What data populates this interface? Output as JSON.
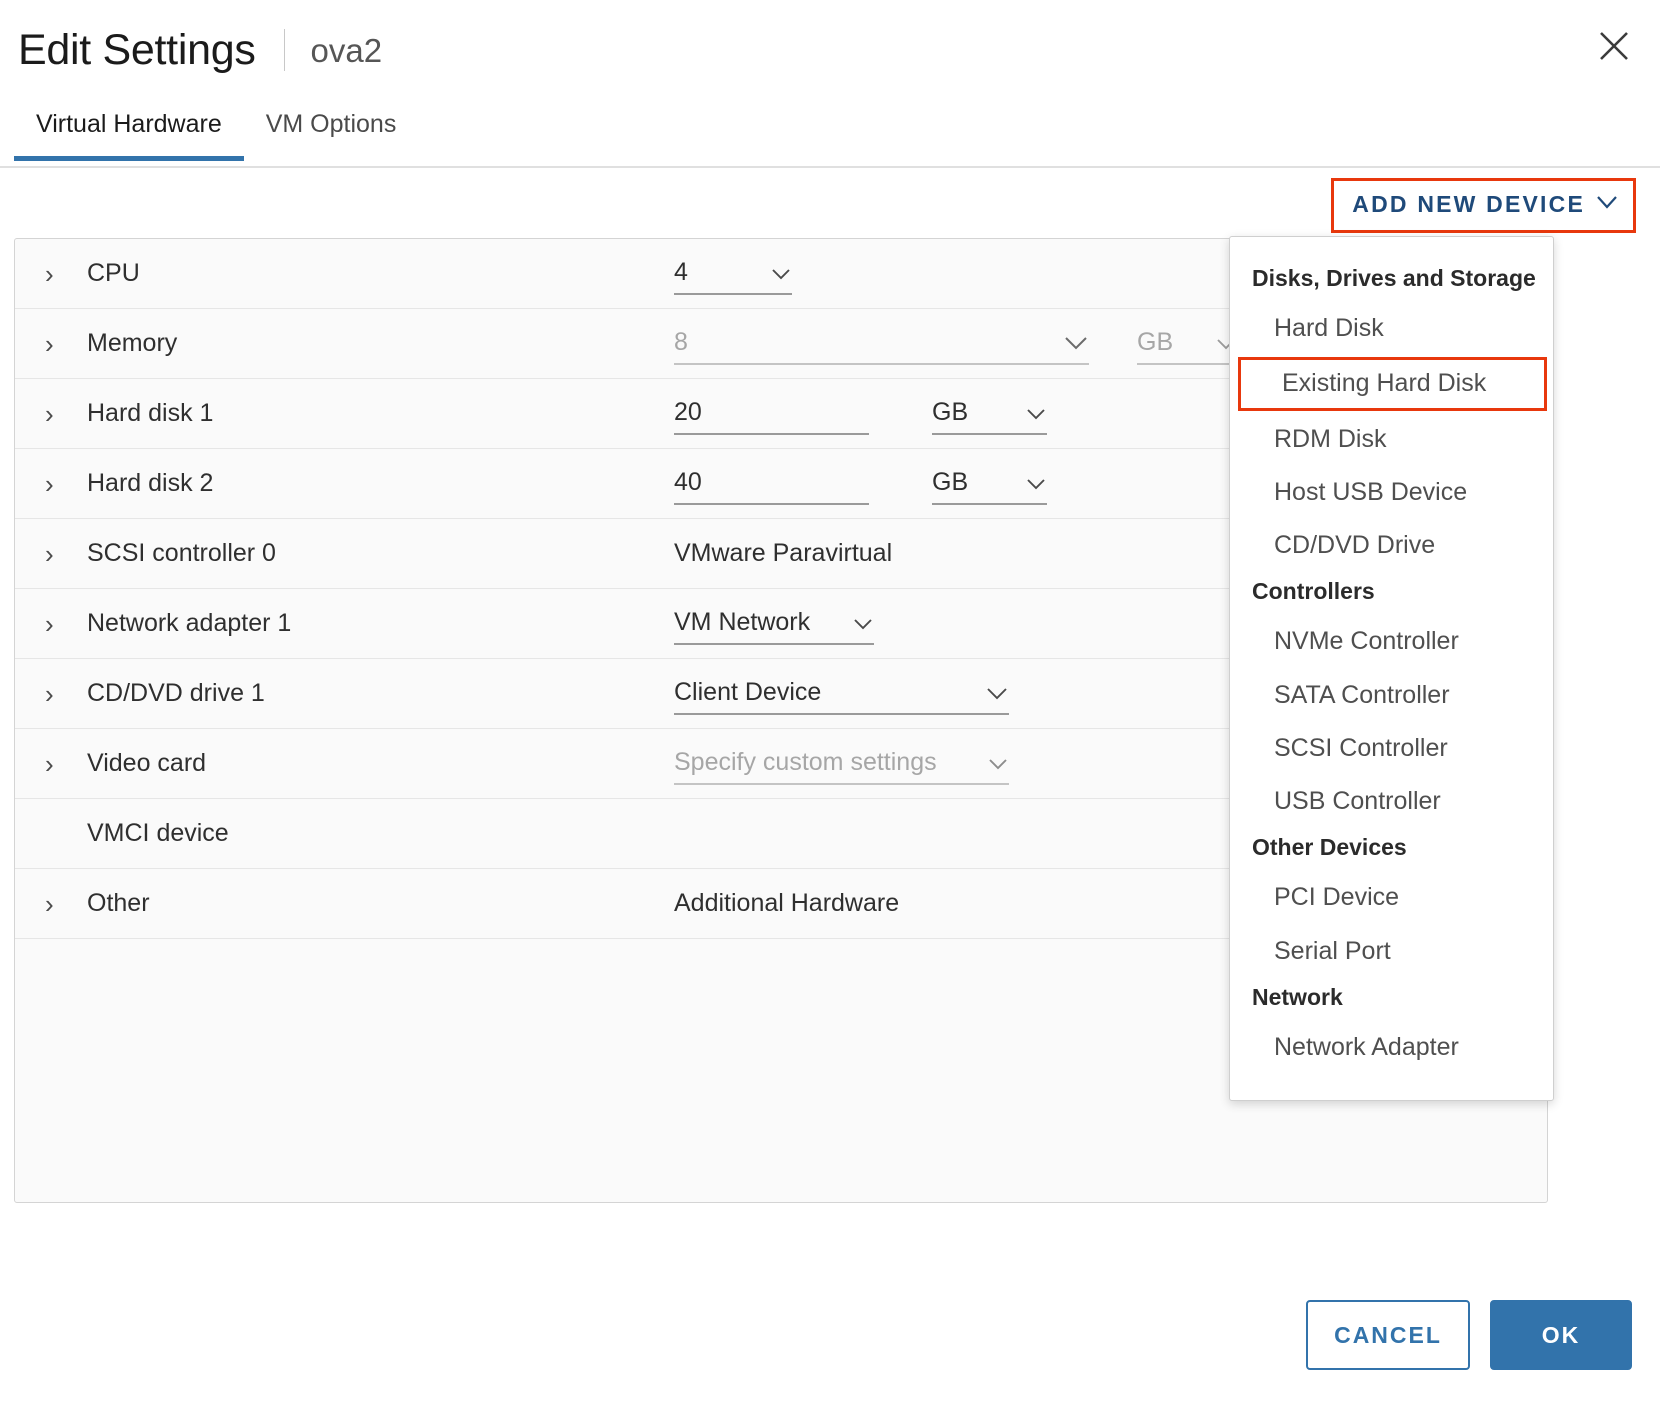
{
  "header": {
    "title": "Edit Settings",
    "subtitle": "ova2",
    "close_icon": "close-icon"
  },
  "tabs": [
    {
      "label": "Virtual Hardware",
      "active": true
    },
    {
      "label": "VM Options",
      "active": false
    }
  ],
  "toolbar": {
    "add_new_device_label": "ADD NEW DEVICE",
    "chevron": "ˇ",
    "highlight_color": "#e8380d",
    "link_color": "#1f4a7a"
  },
  "hardware_rows": [
    {
      "label": "CPU",
      "value": "4",
      "unit": "",
      "type": "select-small",
      "muted": false
    },
    {
      "label": "Memory",
      "value": "8",
      "unit": "GB",
      "type": "select-unit",
      "muted": true
    },
    {
      "label": "Hard disk 1",
      "value": "20",
      "unit": "GB",
      "type": "input-unit",
      "muted": false
    },
    {
      "label": "Hard disk 2",
      "value": "40",
      "unit": "GB",
      "type": "input-unit",
      "muted": false
    },
    {
      "label": "SCSI controller 0",
      "value": "VMware Paravirtual",
      "unit": "",
      "type": "text",
      "muted": false
    },
    {
      "label": "Network adapter 1",
      "value": "VM Network",
      "unit": "",
      "type": "select-inline",
      "muted": false
    },
    {
      "label": "CD/DVD drive 1",
      "value": "Client Device",
      "unit": "",
      "type": "select-wide",
      "muted": false
    },
    {
      "label": "Video card",
      "value": "Specify custom settings",
      "unit": "",
      "type": "select-inline",
      "muted": true
    },
    {
      "label": "VMCI device",
      "value": "",
      "unit": "",
      "type": "none",
      "muted": false
    },
    {
      "label": "Other",
      "value": "Additional Hardware",
      "unit": "",
      "type": "text",
      "muted": false
    }
  ],
  "add_device_menu": {
    "groups": [
      {
        "title": "Disks, Drives and Storage",
        "items": [
          {
            "label": "Hard Disk",
            "highlighted": false
          },
          {
            "label": "Existing Hard Disk",
            "highlighted": true
          },
          {
            "label": "RDM Disk",
            "highlighted": false
          },
          {
            "label": "Host USB Device",
            "highlighted": false
          },
          {
            "label": "CD/DVD Drive",
            "highlighted": false
          }
        ]
      },
      {
        "title": "Controllers",
        "items": [
          {
            "label": "NVMe Controller",
            "highlighted": false
          },
          {
            "label": "SATA Controller",
            "highlighted": false
          },
          {
            "label": "SCSI Controller",
            "highlighted": false
          },
          {
            "label": "USB Controller",
            "highlighted": false
          }
        ]
      },
      {
        "title": "Other Devices",
        "items": [
          {
            "label": "PCI Device",
            "highlighted": false
          },
          {
            "label": "Serial Port",
            "highlighted": false
          }
        ]
      },
      {
        "title": "Network",
        "items": [
          {
            "label": "Network Adapter",
            "highlighted": false
          }
        ]
      }
    ]
  },
  "footer": {
    "cancel_label": "CANCEL",
    "ok_label": "OK",
    "primary_color": "#3273ab"
  }
}
